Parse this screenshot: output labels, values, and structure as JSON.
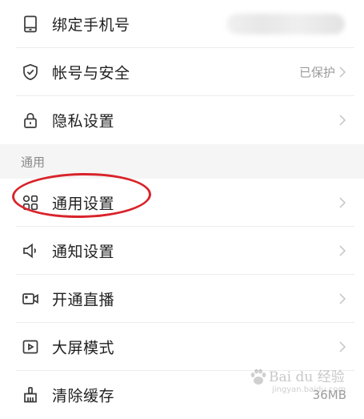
{
  "rows_top": [
    {
      "label": "绑定手机号",
      "icon": "phone-icon"
    },
    {
      "label": "帐号与安全",
      "value": "已保护",
      "icon": "shield-check-icon"
    },
    {
      "label": "隐私设置",
      "icon": "lock-icon"
    }
  ],
  "section": {
    "title": "通用"
  },
  "rows_bottom": [
    {
      "label": "通用设置",
      "icon": "grid-icon"
    },
    {
      "label": "通知设置",
      "icon": "speaker-icon"
    },
    {
      "label": "开通直播",
      "icon": "video-camera-icon"
    },
    {
      "label": "大屏模式",
      "icon": "play-screen-icon"
    },
    {
      "label": "清除缓存",
      "value": "36MB",
      "icon": "broom-icon"
    }
  ],
  "watermark": {
    "text": "Bai du 经验",
    "sub": "jingyan.baidu.com"
  },
  "colors": {
    "highlight": "#d9232a",
    "divider": "#ececec",
    "section_bg": "#f5f5f5"
  }
}
